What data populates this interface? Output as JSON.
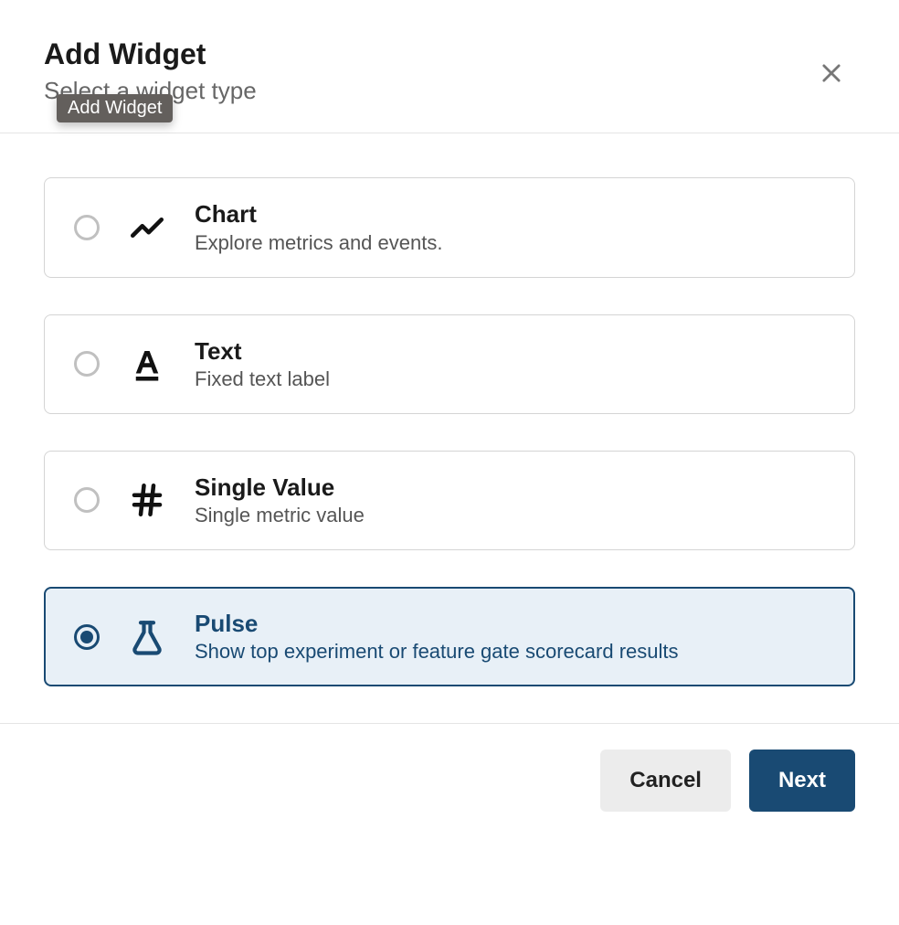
{
  "header": {
    "title": "Add Widget",
    "subtitle": "Select a widget type",
    "tooltip": "Add Widget"
  },
  "options": [
    {
      "id": "chart",
      "icon": "line-chart-icon",
      "title": "Chart",
      "description": "Explore metrics and events.",
      "selected": false
    },
    {
      "id": "text",
      "icon": "text-format-icon",
      "title": "Text",
      "description": "Fixed text label",
      "selected": false
    },
    {
      "id": "single_value",
      "icon": "hash-icon",
      "title": "Single Value",
      "description": "Single metric value",
      "selected": false
    },
    {
      "id": "pulse",
      "icon": "flask-icon",
      "title": "Pulse",
      "description": "Show top experiment or feature gate scorecard results",
      "selected": true
    }
  ],
  "footer": {
    "cancel_label": "Cancel",
    "next_label": "Next"
  }
}
